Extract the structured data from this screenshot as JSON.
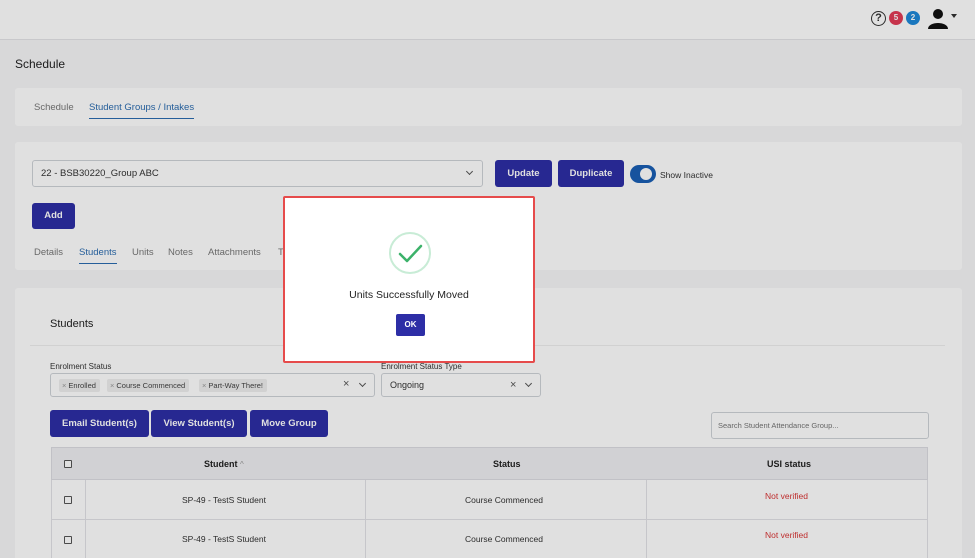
{
  "header": {
    "help_glyph": "?",
    "notifications_red_count": "5",
    "notifications_blue_count": "2"
  },
  "page": {
    "title": "Schedule"
  },
  "top_tabs": [
    {
      "label": "Schedule",
      "active": false
    },
    {
      "label": "Student Groups / Intakes",
      "active": true
    }
  ],
  "group": {
    "selected": "22 - BSB30220_Group ABC",
    "update_label": "Update",
    "duplicate_label": "Duplicate",
    "show_inactive_label": "Show Inactive",
    "show_inactive_on": true,
    "add_label": "Add"
  },
  "sub_tabs": [
    {
      "label": "Details",
      "active": false
    },
    {
      "label": "Students",
      "active": true
    },
    {
      "label": "Units",
      "active": false
    },
    {
      "label": "Notes",
      "active": false
    },
    {
      "label": "Attachments",
      "active": false
    },
    {
      "label": "T",
      "active": false
    }
  ],
  "students_section": {
    "title": "Students",
    "enrolment_status_label": "Enrolment Status",
    "enrolment_status_chips": [
      "Enrolled",
      "Course Commenced",
      "Part-Way There!"
    ],
    "enrolment_status_type_label": "Enrolment Status Type",
    "enrolment_status_type_value": "Ongoing",
    "email_button": "Email Student(s)",
    "view_button": "View Student(s)",
    "move_button": "Move Group",
    "search_placeholder": "Search Student Attendance Group..."
  },
  "table": {
    "headers": {
      "student": "Student",
      "sort_glyph": "^",
      "status": "Status",
      "usi": "USI status"
    },
    "rows": [
      {
        "student": "SP-49 - TestS Student",
        "status": "Course Commenced",
        "usi": "Not verified"
      },
      {
        "student": "SP-49 - TestS Student",
        "status": "Course Commenced",
        "usi": "Not verified"
      }
    ]
  },
  "modal": {
    "message": "Units Successfully Moved",
    "ok_label": "OK"
  },
  "colors": {
    "primary": "#2d2ea6",
    "accent_blue": "#1a5fb4",
    "success_green": "#3cb26a",
    "error_red": "#d93535",
    "modal_border": "#e64b4b"
  }
}
